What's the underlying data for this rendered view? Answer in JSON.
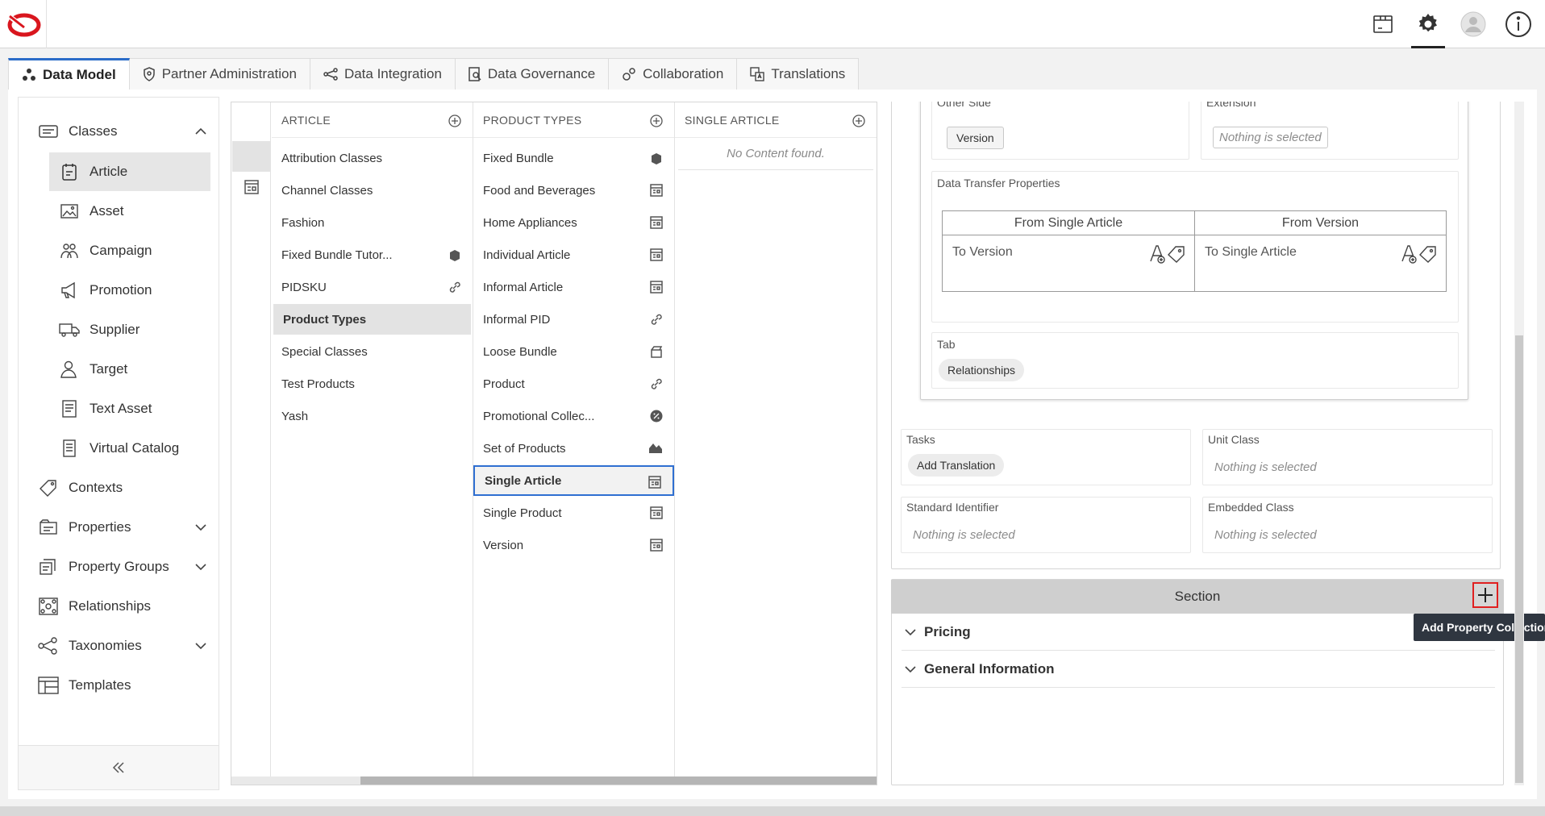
{
  "header": {
    "icons": [
      "package-icon",
      "gear-icon",
      "user-avatar-icon",
      "info-icon"
    ]
  },
  "tabs": [
    {
      "label": "Data Model",
      "icon": "data-model-icon",
      "active": true
    },
    {
      "label": "Partner Administration",
      "icon": "shield-icon"
    },
    {
      "label": "Data Integration",
      "icon": "share-icon"
    },
    {
      "label": "Data Governance",
      "icon": "governance-icon"
    },
    {
      "label": "Collaboration",
      "icon": "gears-icon"
    },
    {
      "label": "Translations",
      "icon": "translate-icon"
    }
  ],
  "sidebar": {
    "classes_label": "Classes",
    "sub_items": [
      {
        "label": "Article",
        "icon": "article-icon",
        "selected": true
      },
      {
        "label": "Asset",
        "icon": "image-icon"
      },
      {
        "label": "Campaign",
        "icon": "campaign-icon"
      },
      {
        "label": "Promotion",
        "icon": "megaphone-icon"
      },
      {
        "label": "Supplier",
        "icon": "truck-icon"
      },
      {
        "label": "Target",
        "icon": "person-icon"
      },
      {
        "label": "Text Asset",
        "icon": "text-doc-icon"
      },
      {
        "label": "Virtual Catalog",
        "icon": "catalog-icon"
      }
    ],
    "items": [
      {
        "label": "Contexts",
        "icon": "tag-icon"
      },
      {
        "label": "Properties",
        "icon": "properties-icon",
        "expandable": true
      },
      {
        "label": "Property Groups",
        "icon": "property-groups-icon",
        "expandable": true
      },
      {
        "label": "Relationships",
        "icon": "relationships-icon"
      },
      {
        "label": "Taxonomies",
        "icon": "taxonomy-icon",
        "expandable": true
      },
      {
        "label": "Templates",
        "icon": "templates-icon"
      }
    ]
  },
  "columns": {
    "article": {
      "header": "ARTICLE",
      "items": [
        {
          "label": "Attribution Classes"
        },
        {
          "label": "Channel Classes"
        },
        {
          "label": "Fashion"
        },
        {
          "label": "Fixed Bundle Tutor...",
          "icon": "box-icon"
        },
        {
          "label": "PIDSKU",
          "icon": "link-icon"
        },
        {
          "label": "Product Types",
          "selected": true
        },
        {
          "label": "Special Classes"
        },
        {
          "label": "Test Products"
        },
        {
          "label": "Yash"
        }
      ]
    },
    "product_types": {
      "header": "PRODUCT TYPES",
      "items": [
        {
          "label": "Fixed Bundle",
          "icon": "box-icon"
        },
        {
          "label": "Food and Beverages",
          "icon": "form-icon"
        },
        {
          "label": "Home Appliances",
          "icon": "form-icon"
        },
        {
          "label": "Individual Article",
          "icon": "form-icon"
        },
        {
          "label": "Informal Article",
          "icon": "form-icon"
        },
        {
          "label": "Informal PID",
          "icon": "link-icon"
        },
        {
          "label": "Loose Bundle",
          "icon": "open-box-icon"
        },
        {
          "label": "Product",
          "icon": "link-icon"
        },
        {
          "label": "Promotional Collec...",
          "icon": "percent-icon"
        },
        {
          "label": "Set of Products",
          "icon": "set-icon"
        },
        {
          "label": "Single Article",
          "icon": "form-icon",
          "focused": true
        },
        {
          "label": "Single Product",
          "icon": "form-icon"
        },
        {
          "label": "Version",
          "icon": "form-icon"
        }
      ]
    },
    "single_article": {
      "header": "SINGLE ARTICLE",
      "empty_text": "No Content found."
    }
  },
  "detail": {
    "other_side": {
      "title": "Other Side",
      "chip": "Version"
    },
    "extension": {
      "title": "Extension",
      "placeholder": "Nothing is selected"
    },
    "data_transfer": {
      "title": "Data Transfer Properties",
      "col1_header": "From Single Article",
      "col2_header": "From Version",
      "col1_value": "To Version",
      "col2_value": "To Single Article"
    },
    "tab": {
      "title": "Tab",
      "chip": "Relationships"
    },
    "tasks": {
      "title": "Tasks",
      "chip": "Add Translation"
    },
    "unit_class": {
      "title": "Unit Class",
      "placeholder": "Nothing is selected"
    },
    "standard_identifier": {
      "title": "Standard Identifier",
      "placeholder": "Nothing is selected"
    },
    "embedded_class": {
      "title": "Embedded Class",
      "placeholder": "Nothing is selected"
    },
    "section": {
      "title": "Section",
      "tooltip": "Add Property Collection",
      "rows": [
        "Pricing",
        "General Information"
      ]
    }
  }
}
